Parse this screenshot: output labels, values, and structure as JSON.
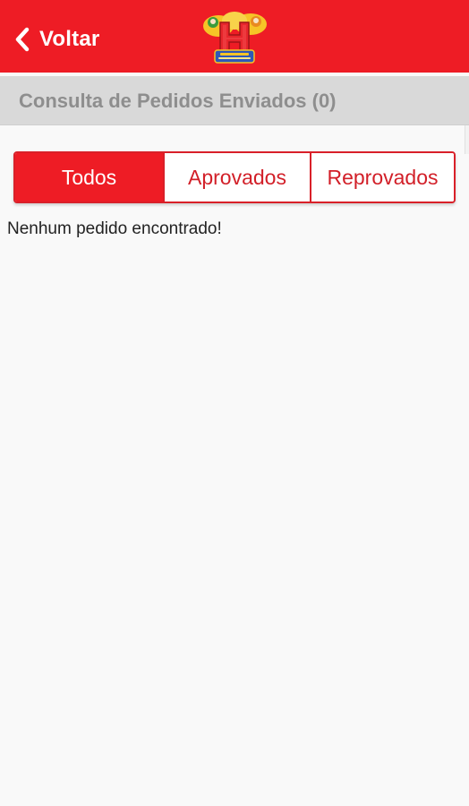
{
  "colors": {
    "brand_red": "#ee1c25",
    "subheader_bg": "#d9d9d9",
    "page_bg": "#f9f9f9"
  },
  "header": {
    "back_label": "Voltar",
    "back_icon": "chevron-left-icon",
    "logo_icon": "hefer-logo"
  },
  "subheader": {
    "title": "Consulta de Pedidos Enviados (0)"
  },
  "tabs": [
    {
      "label": "Todos",
      "active": true
    },
    {
      "label": "Aprovados",
      "active": false
    },
    {
      "label": "Reprovados",
      "active": false
    }
  ],
  "content": {
    "empty_message": "Nenhum pedido encontrado!"
  }
}
